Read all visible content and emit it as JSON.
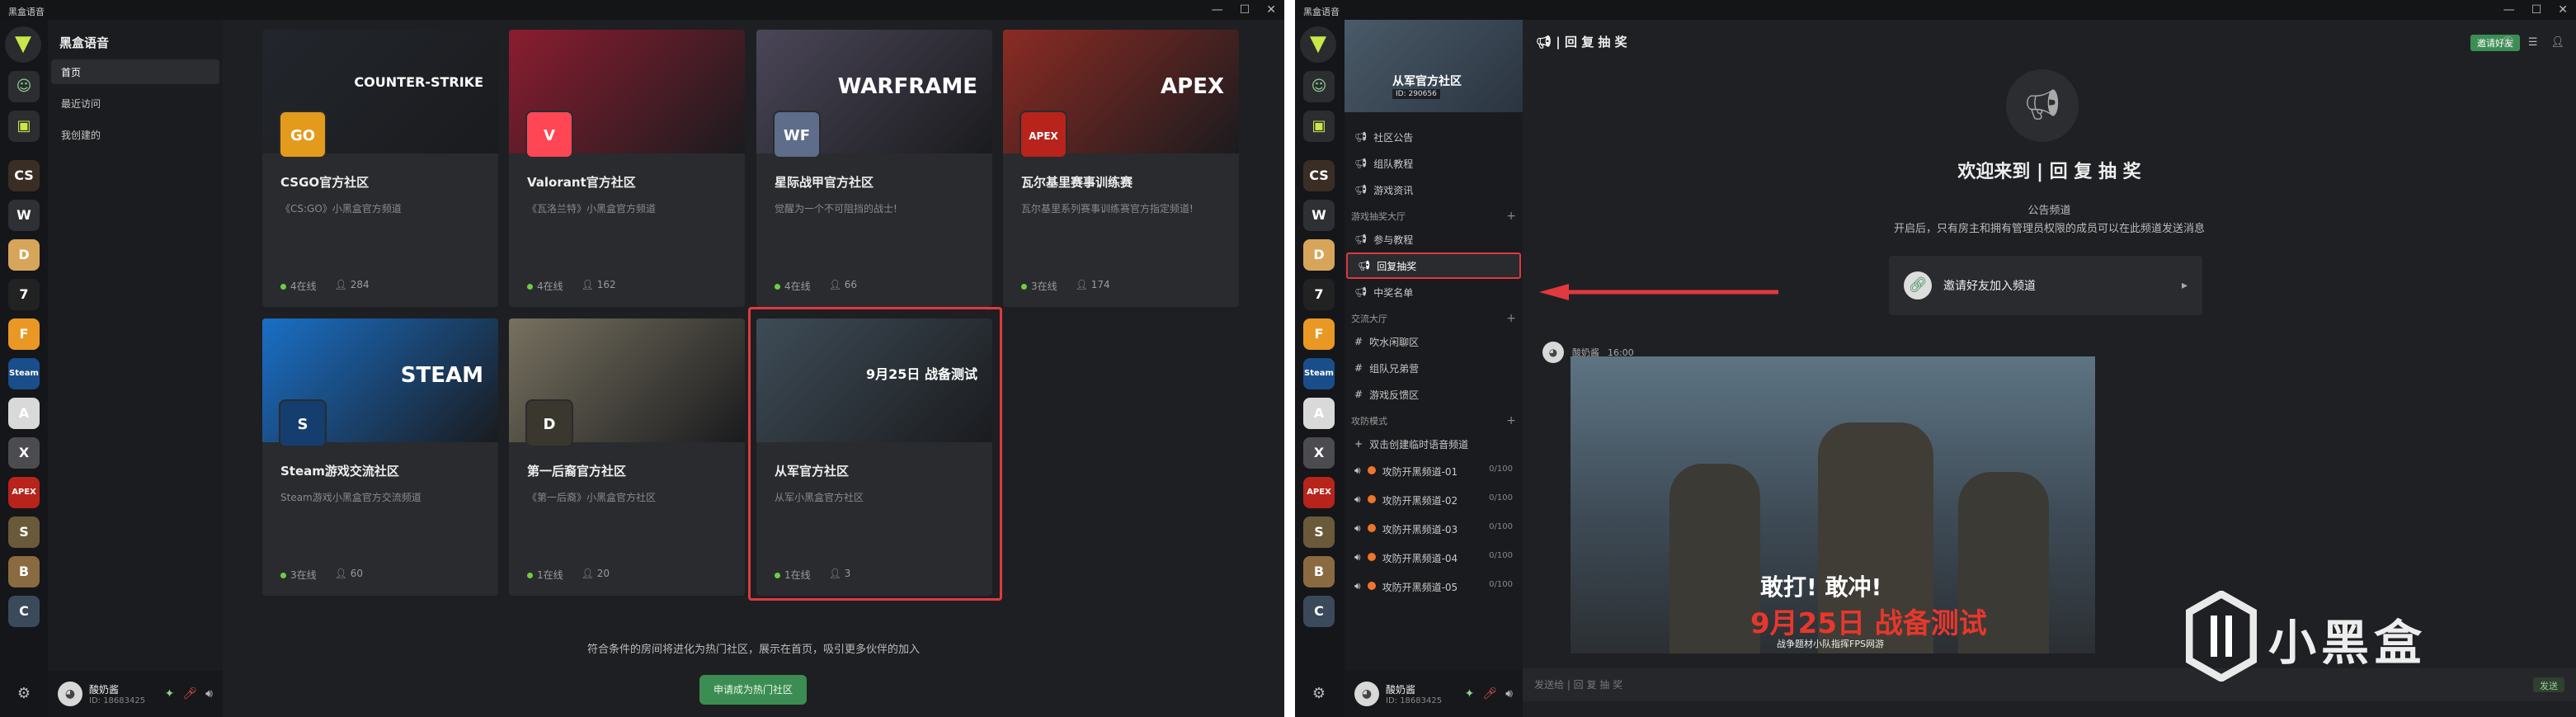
{
  "left": {
    "titlebar": "黑盒语音",
    "sidebar": {
      "title": "黑盒语音",
      "items": [
        {
          "label": "首页",
          "active": true
        },
        {
          "label": "最近访问",
          "active": false
        },
        {
          "label": "我创建的",
          "active": false
        }
      ]
    },
    "rail_icons": [
      "CS",
      "W",
      "D",
      "7",
      "F",
      "Steam",
      "A",
      "X",
      "APEX",
      "S",
      "B",
      "C"
    ],
    "cards": [
      {
        "title": "CSGO官方社区",
        "desc": "《CS:GO》小黑盒官方频道",
        "online": "4在线",
        "members": "284",
        "badge": "GO",
        "banner_text": "COUNTER-STRIKE",
        "color": "#22262c",
        "badge_color": "#e39b1c"
      },
      {
        "title": "Valorant官方社区",
        "desc": "《瓦洛兰特》小黑盒官方频道",
        "online": "4在线",
        "members": "162",
        "badge": "V",
        "banner_text": "",
        "color": "#8b1d30",
        "badge_color": "#ff4655"
      },
      {
        "title": "星际战甲官方社区",
        "desc": "觉醒为一个不可阻挡的战士!",
        "online": "4在线",
        "members": "66",
        "badge": "WF",
        "banner_text": "WARFRAME",
        "color": "#4b4658",
        "badge_color": "#5d6d8a"
      },
      {
        "title": "瓦尔基里赛事训练赛",
        "desc": "瓦尔基里系列赛事训练赛官方指定频道!",
        "online": "3在线",
        "members": "174",
        "badge": "APEX",
        "banner_text": "APEX",
        "color": "#8c2b24",
        "badge_color": "#b8231c"
      },
      {
        "title": "Steam游戏交流社区",
        "desc": "Steam游戏小黑盒官方交流频道",
        "online": "3在线",
        "members": "60",
        "badge": "S",
        "banner_text": "STEAM",
        "color": "#1a6fc7",
        "badge_color": "#143e6e"
      },
      {
        "title": "第一后裔官方社区",
        "desc": "《第一后裔》小黑盒官方社区",
        "online": "1在线",
        "members": "20",
        "badge": "D",
        "banner_text": "",
        "color": "#77715f",
        "badge_color": "#3a372e"
      },
      {
        "title": "从军官方社区",
        "desc": "从军小黑盒官方社区",
        "online": "1在线",
        "members": "3",
        "badge": "",
        "banner_text": "9月25日 战备测试",
        "color": "#3e4c57",
        "badge_color": "#2a2b2e"
      }
    ],
    "hint": "符合条件的房间将进化为热门社区，展示在首页，吸引更多伙伴的加入",
    "apply_button": "申请成为热门社区",
    "user": {
      "name": "酸奶酱",
      "id": "ID: 18683425"
    }
  },
  "right": {
    "titlebar": "黑盒语音",
    "community": {
      "name": "从军官方社区",
      "id": "ID: 290656"
    },
    "channels_top": [
      "社区公告",
      "组队教程",
      "游戏资讯"
    ],
    "category1": "游戏抽奖大厅",
    "category1_items": [
      "参与教程",
      "回复抽奖",
      "中奖名单"
    ],
    "selected_channel": "回复抽奖",
    "category2": "交流大厅",
    "category2_items": [
      "吹水闲聊区",
      "组队兄弟营",
      "游戏反馈区"
    ],
    "category3": "攻防模式",
    "create_temp": "双击创建临时语音频道",
    "voice_channels": [
      {
        "name": "攻防开黑频道-01",
        "count": "0/100"
      },
      {
        "name": "攻防开黑频道-02",
        "count": "0/100"
      },
      {
        "name": "攻防开黑频道-03",
        "count": "0/100"
      },
      {
        "name": "攻防开黑频道-04",
        "count": "0/100"
      },
      {
        "name": "攻防开黑频道-05",
        "count": "0/100"
      }
    ],
    "chat_title": "| 回 复 抽 奖",
    "invite_button": "邀请好友",
    "welcome": "欢迎来到 | 回 复 抽 奖",
    "channel_type": "公告频道",
    "notice": "开启后，只有房主和拥有管理员权限的成员可以在此频道发送消息",
    "invite_box": "邀请好友加入频道",
    "msg_author": "酸奶酱",
    "msg_time": "16:00",
    "poster": {
      "title": "敢打! 敢冲!",
      "date": "9月25日 战备测试",
      "sub": "战争题材小队指挥FPS网游"
    },
    "input_placeholder": "发送给 | 回 复 抽 奖",
    "send": "发送",
    "user": {
      "name": "酸奶酱",
      "id": "ID: 18683425"
    }
  },
  "watermark": "小黑盒"
}
